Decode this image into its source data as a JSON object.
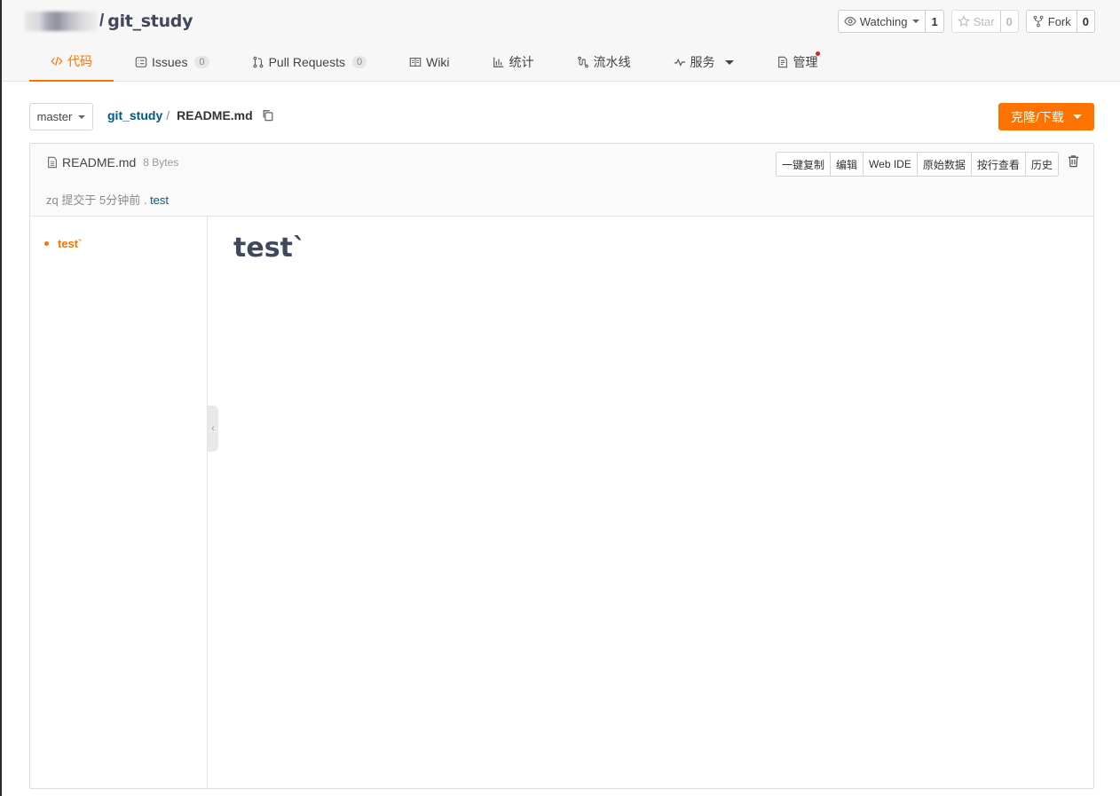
{
  "repo": {
    "separator": "/",
    "name": "git_study"
  },
  "actions": {
    "watch": {
      "label": "Watching",
      "count": "1"
    },
    "star": {
      "label": "Star",
      "count": "0"
    },
    "fork": {
      "label": "Fork",
      "count": "0"
    }
  },
  "tabs": [
    {
      "label": "代码",
      "icon": "code-icon",
      "active": true
    },
    {
      "label": "Issues",
      "icon": "issues-icon",
      "badge": "0"
    },
    {
      "label": "Pull Requests",
      "icon": "pull-request-icon",
      "badge": "0"
    },
    {
      "label": "Wiki",
      "icon": "book-icon"
    },
    {
      "label": "统计",
      "icon": "bar-chart-icon"
    },
    {
      "label": "流水线",
      "icon": "pipeline-icon"
    },
    {
      "label": "服务",
      "icon": "pulse-icon"
    },
    {
      "label": "管理",
      "icon": "manage-icon"
    }
  ],
  "branch": {
    "label": "master"
  },
  "breadcrumb": {
    "repo": "git_study",
    "separator": "/",
    "file": "README.md"
  },
  "clone_button": {
    "label": "克隆/下载"
  },
  "file": {
    "name": "README.md",
    "size": "8 Bytes",
    "tools": [
      "一键复制",
      "编辑",
      "Web IDE",
      "原始数据",
      "按行查看",
      "历史"
    ],
    "commit": {
      "author": "zq",
      "text": "提交于 5分钟前 .",
      "message": "test"
    }
  },
  "toc": {
    "items": [
      "test`"
    ]
  },
  "content": {
    "heading": "test`"
  },
  "colors": {
    "accent": "#fe7300",
    "link": "#005980",
    "title": "#40485b"
  }
}
